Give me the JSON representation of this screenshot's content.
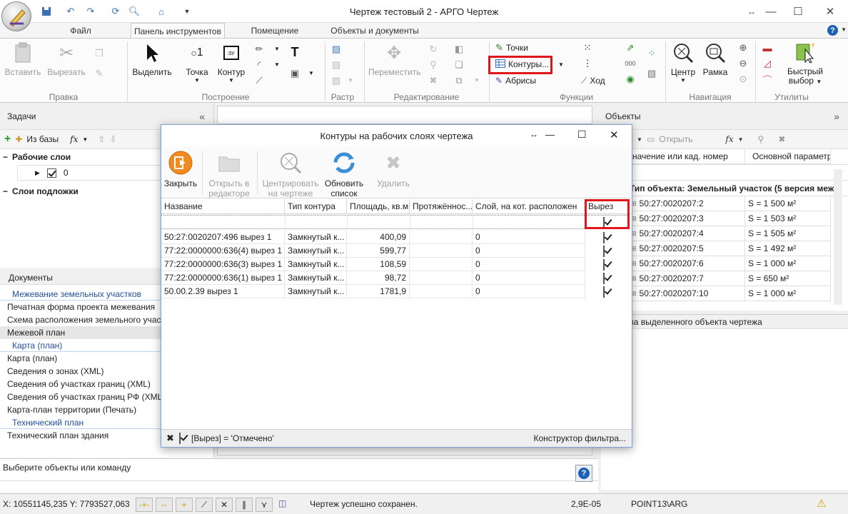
{
  "window": {
    "title": "Чертеж тестовый 2 - АРГО Чертеж",
    "controls": [
      "minimize",
      "maximize",
      "close"
    ]
  },
  "ribbon_tabs": [
    {
      "label": "Файл"
    },
    {
      "label": "Панель инструментов",
      "active": true
    },
    {
      "label": "Помещение"
    },
    {
      "label": "Объекты и документы"
    }
  ],
  "ribbon": {
    "edit_group": {
      "label": "Правка",
      "paste": "Вставить",
      "cut": "Вырезать"
    },
    "build_group": {
      "label": "Построение",
      "select": "Выделить",
      "point": "Точка",
      "contour": "Контур"
    },
    "raster_group": {
      "label": "Растр"
    },
    "editing_group": {
      "label": "Редактирование",
      "move": "Переместить"
    },
    "functions_group": {
      "label": "Функции",
      "points": "Точки",
      "contours": "Контуры...",
      "abrisy": "Абрисы",
      "hod": "Ход"
    },
    "nav_group": {
      "label": "Навигация",
      "center": "Центр",
      "frame": "Рамка"
    },
    "utils_group": {
      "label": "Утилиты",
      "quick_select_1": "Быстрый",
      "quick_select_2": "выбор"
    }
  },
  "tasks_panel": {
    "title": "Задачи",
    "from_db": "Из базы",
    "work_layers": "Рабочие слои",
    "layer_value": "0",
    "base_layers": "Слои подложки"
  },
  "documents_panel": {
    "title": "Документы",
    "categories": [
      {
        "label": "Межевание земельных участков",
        "items": [
          "Печатная форма проекта межевания",
          "Схема расположения земельного участка",
          "Межевой план"
        ]
      },
      {
        "label": "Карта (план)",
        "items": [
          "Карта (план)",
          "Сведения о зонах (XML)",
          "Сведения об участках границ (XML)",
          "Сведения об участках границ РФ (XML)",
          "Карта-план территории (Печать)"
        ]
      },
      {
        "label": "Технический план",
        "items": [
          "Технический план здания"
        ]
      }
    ],
    "selected_item": "Межевой план"
  },
  "command_line": {
    "text": "Выберите объекты или команду"
  },
  "objects_panel": {
    "title": "Объекты",
    "open_label": "Открыть",
    "columns": [
      "начение или кад. номер",
      "Основной параметр"
    ],
    "group_title": "Тип объекта: Земельный участок (5 версия меже",
    "rows": [
      {
        "id": "50:27:0020207:2",
        "param": "S = 1 500 м²"
      },
      {
        "id": "50:27:0020207:3",
        "param": "S = 1 503 м²"
      },
      {
        "id": "50:27:0020207:4",
        "param": "S = 1 505 м²"
      },
      {
        "id": "50:27:0020207:5",
        "param": "S = 1 492 м²"
      },
      {
        "id": "50:27:0020207:6",
        "param": "S = 1 000 м²"
      },
      {
        "id": "50:27:0020207:7",
        "param": "S = 650 м²"
      },
      {
        "id": "50:27:0020207:10",
        "param": "S = 1 000 м²"
      }
    ]
  },
  "props_panel": {
    "title": "тва выделенного объекта чертежа"
  },
  "dialog": {
    "title": "Контуры на рабочих слоях чертежа",
    "toolbar": {
      "close_1": "Закрыть",
      "open_editor_1": "Открыть в",
      "open_editor_2": "редакторе",
      "center_1": "Центрировать",
      "center_2": "на чертеже",
      "refresh_1": "Обновить",
      "refresh_2": "список",
      "delete": "Удалить"
    },
    "columns": [
      "Название",
      "Тип контура",
      "Площадь, кв.м.",
      "Протяжённос...",
      "Слой, на кот. расположен",
      "Вырез"
    ],
    "rows": [
      {
        "name": "50:27:0020207:496 вырез 1",
        "type": "Замкнутый к...",
        "area": "400,09",
        "length": "",
        "layer": "0",
        "cut": true
      },
      {
        "name": "77:22:0000000:636(4) вырез 1",
        "type": "Замкнутый к...",
        "area": "599,77",
        "length": "",
        "layer": "0",
        "cut": true
      },
      {
        "name": "77:22:0000000:636(3) вырез 1",
        "type": "Замкнутый к...",
        "area": "108,59",
        "length": "",
        "layer": "0",
        "cut": true
      },
      {
        "name": "77:22:0000000:636(1) вырез 1",
        "type": "Замкнутый к...",
        "area": "98,72",
        "length": "",
        "layer": "0",
        "cut": true
      },
      {
        "name": "50.00.2.39 вырез 1",
        "type": "Замкнутый к...",
        "area": "1781,9",
        "length": "",
        "layer": "0",
        "cut": true
      }
    ],
    "filter_text": "[Вырез] = 'Отмечено'",
    "filter_builder": "Конструктор фильтра..."
  },
  "statusbar": {
    "coords": "X: 10551145,235 Y: 7793527,063",
    "message": "Чертеж успешно сохранен.",
    "scale": "2,9E-05",
    "point": "POINT13\\ARG"
  },
  "colors": {
    "highlight": "#e0161b",
    "accent": "#1f5fb5"
  }
}
